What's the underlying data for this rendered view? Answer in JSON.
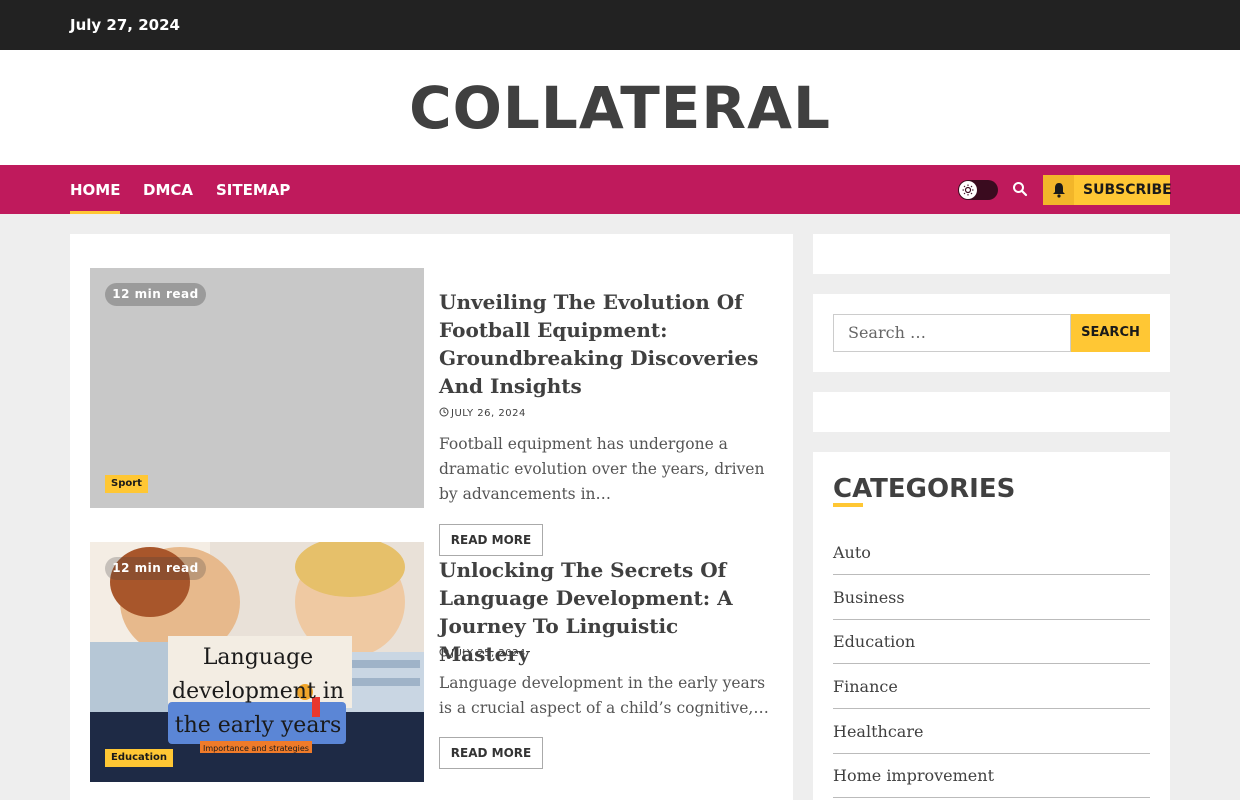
{
  "topbar": {
    "date": "July 27, 2024"
  },
  "site": {
    "title": "COLLATERAL"
  },
  "nav": {
    "items": [
      "HOME",
      "DMCA",
      "SITEMAP"
    ],
    "subscribe_label": "SUBSCRIBE"
  },
  "posts": [
    {
      "read_time": "12 min read",
      "category": "Sport",
      "title": "Unveiling The Evolution Of Football Equipment: Groundbreaking Discoveries And Insights",
      "date": "JULY 26, 2024",
      "excerpt": "Football equipment has undergone a dramatic evolution over the years, driven by advancements in…",
      "read_more": "READ MORE"
    },
    {
      "read_time": "12 min read",
      "category": "Education",
      "title": "Unlocking The Secrets Of Language Development: A Journey To Linguistic Mastery",
      "date": "JULY 25, 2024",
      "excerpt": "Language development in the early years is a crucial aspect of a child’s cognitive,…",
      "read_more": "READ MORE",
      "image_text": {
        "line1": "Language",
        "line2": "development in",
        "line3": "the early years",
        "subline": "Importance and strategies"
      }
    }
  ],
  "sidebar": {
    "search_placeholder": "Search …",
    "search_button": "SEARCH",
    "categories_heading": "CATEGORIES",
    "categories": [
      "Auto",
      "Business",
      "Education",
      "Finance",
      "Healthcare",
      "Home improvement"
    ]
  },
  "colors": {
    "nav_bg": "#bf1a5c",
    "accent": "#ffc734",
    "topbar_bg": "#222222"
  }
}
